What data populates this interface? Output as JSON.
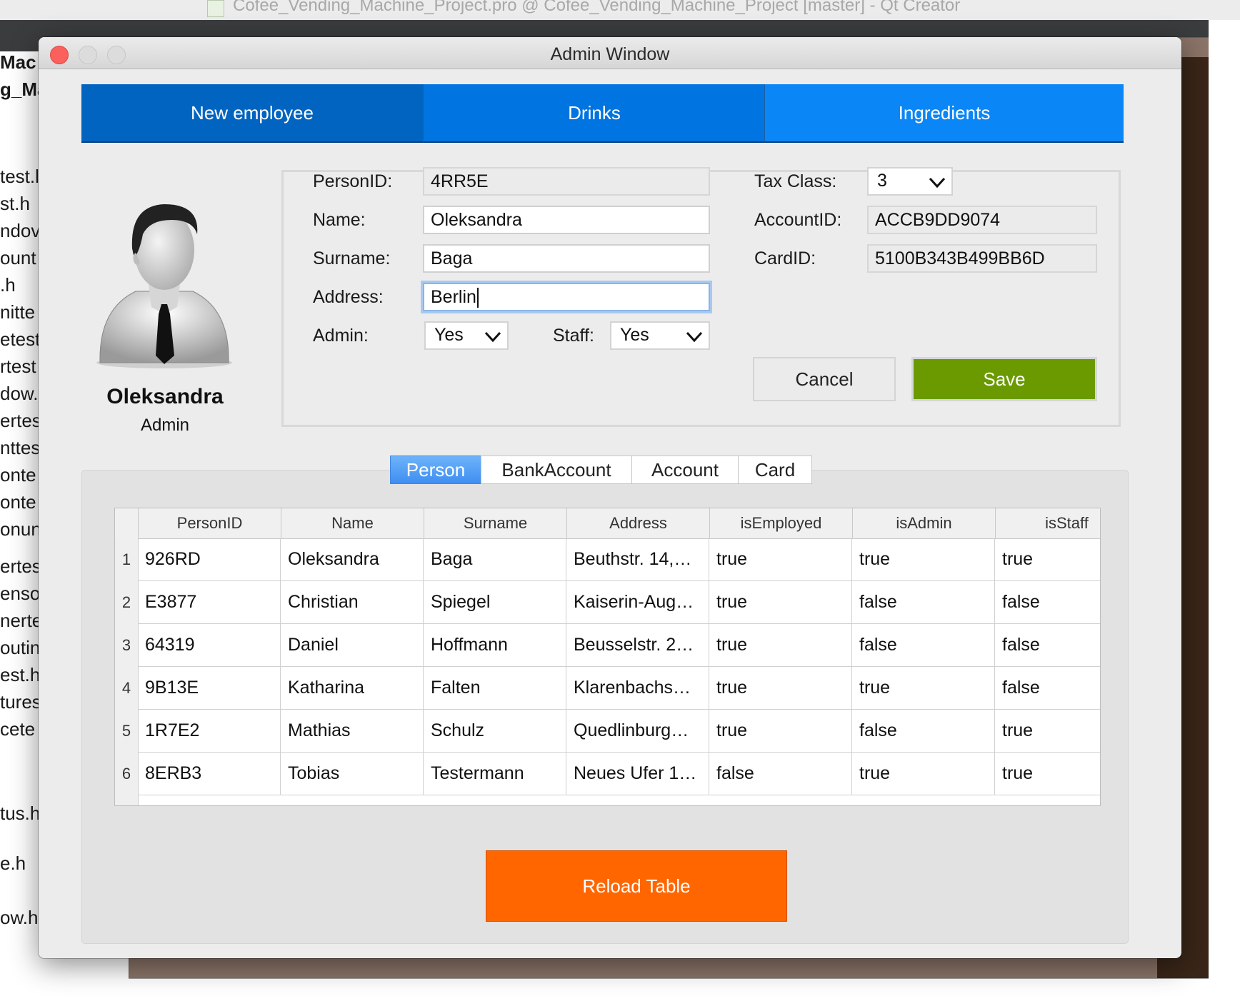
{
  "background": {
    "window_title": "Cofee_Vending_Machine_Project.pro @ Cofee_Vending_Machine_Project [master] - Qt Creator",
    "file_list": [
      "Mac",
      "g_Ma",
      "test.l",
      "st.h",
      "ndov",
      "ount",
      ".h",
      "nitte",
      "etest",
      "rtest",
      "dow.",
      "ertes",
      "nttes",
      "onte",
      "onte",
      "onun",
      "",
      "ertes",
      "enso",
      "nerte",
      "outin",
      "est.h",
      "tures",
      "cete",
      "",
      "",
      "tus.h",
      "",
      "e.h",
      "",
      "ow.h"
    ]
  },
  "window": {
    "title": "Admin Window"
  },
  "nav": {
    "new_employee": "New employee",
    "drinks": "Drinks",
    "ingredients": "Ingredients"
  },
  "profile": {
    "name": "Oleksandra",
    "role": "Admin"
  },
  "form": {
    "person_id_label": "PersonID:",
    "person_id": "4RR5E",
    "name_label": "Name:",
    "name": "Oleksandra",
    "surname_label": "Surname:",
    "surname": "Baga",
    "address_label": "Address:",
    "address": "Berlin",
    "admin_label": "Admin:",
    "admin": "Yes",
    "staff_label": "Staff:",
    "staff": "Yes",
    "tax_class_label": "Tax Class:",
    "tax_class": "3",
    "account_id_label": "AccountID:",
    "account_id": "ACCB9DD9074",
    "card_id_label": "CardID:",
    "card_id": "5100B343B499BB6D",
    "cancel": "Cancel",
    "save": "Save"
  },
  "tabs": [
    {
      "label": "Person",
      "active": true
    },
    {
      "label": "BankAccount",
      "active": false
    },
    {
      "label": "Account",
      "active": false
    },
    {
      "label": "Card",
      "active": false
    }
  ],
  "table": {
    "columns": [
      "PersonID",
      "Name",
      "Surname",
      "Address",
      "isEmployed",
      "isAdmin",
      "isStaff"
    ],
    "row_numbers": [
      "1",
      "2",
      "3",
      "4",
      "5",
      "6"
    ],
    "rows": [
      [
        "926RD",
        "Oleksandra",
        "Baga",
        "Beuthstr. 14,…",
        "true",
        "true",
        "true"
      ],
      [
        "E3877",
        "Christian",
        "Spiegel",
        "Kaiserin-Aug…",
        "true",
        "false",
        "false"
      ],
      [
        "64319",
        "Daniel",
        "Hoffmann",
        "Beusselstr. 2…",
        "true",
        "false",
        "false"
      ],
      [
        "9B13E",
        "Katharina",
        "Falten",
        "Klarenbachs…",
        "true",
        "true",
        "false"
      ],
      [
        "1R7E2",
        "Mathias",
        "Schulz",
        "Quedlinburg…",
        "true",
        "false",
        "true"
      ],
      [
        "8ERB3",
        "Tobias",
        "Testermann",
        "Neues Ufer 1…",
        "false",
        "true",
        "true"
      ]
    ]
  },
  "reload_button": "Reload Table",
  "colors": {
    "nav_new": "#0064c0",
    "nav_drinks": "#0074e0",
    "nav_ingredients": "#0a86f6",
    "save": "#6a9a00",
    "reload": "#ff6600",
    "tab_active": "#3e8ef2"
  }
}
